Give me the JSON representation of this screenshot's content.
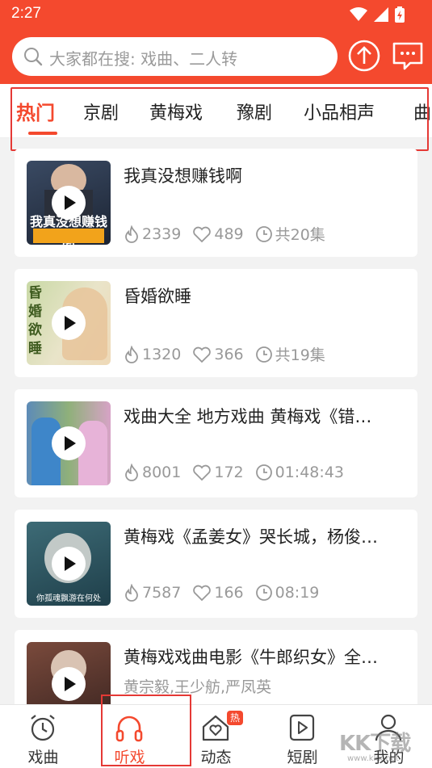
{
  "status_bar": {
    "time": "2:27"
  },
  "search": {
    "placeholder": "大家都在搜: 戏曲、二人转"
  },
  "tabs": [
    {
      "label": "热门",
      "active": true
    },
    {
      "label": "京剧"
    },
    {
      "label": "黄梅戏"
    },
    {
      "label": "豫剧"
    },
    {
      "label": "小品相声"
    },
    {
      "label": "曲"
    }
  ],
  "items": [
    {
      "title": "我真没想赚钱啊",
      "plays": "2339",
      "likes": "489",
      "duration": "共20集",
      "thumb_caption": "我真没想赚钱啊"
    },
    {
      "title": "昏婚欲睡",
      "plays": "1320",
      "likes": "366",
      "duration": "共19集",
      "thumb_caption": "昏婚欲睡"
    },
    {
      "title": "戏曲大全 地方戏曲 黄梅戏《错…",
      "plays": "8001",
      "likes": "172",
      "duration": "01:48:43"
    },
    {
      "title": "黄梅戏《孟姜女》哭长城，杨俊…",
      "plays": "7587",
      "likes": "166",
      "duration": "08:19",
      "thumb_caption": "你孤魂飘游在何处"
    },
    {
      "title": "黄梅戏戏曲电影《牛郎织女》全…",
      "subtitle": "黄宗毅,王少舫,严凤英"
    }
  ],
  "tabbar": [
    {
      "label": "戏曲",
      "icon": "alarm-clock-icon"
    },
    {
      "label": "听戏",
      "icon": "headphones-icon",
      "active": true
    },
    {
      "label": "动态",
      "icon": "home-heart-icon",
      "badge": "热"
    },
    {
      "label": "短剧",
      "icon": "video-play-icon"
    },
    {
      "label": "我的",
      "icon": "person-icon"
    }
  ],
  "watermark": {
    "text": "KK下载",
    "url": "www.kkx.net"
  },
  "colors": {
    "accent": "#f4492e",
    "highlight_frame": "#e53935"
  }
}
